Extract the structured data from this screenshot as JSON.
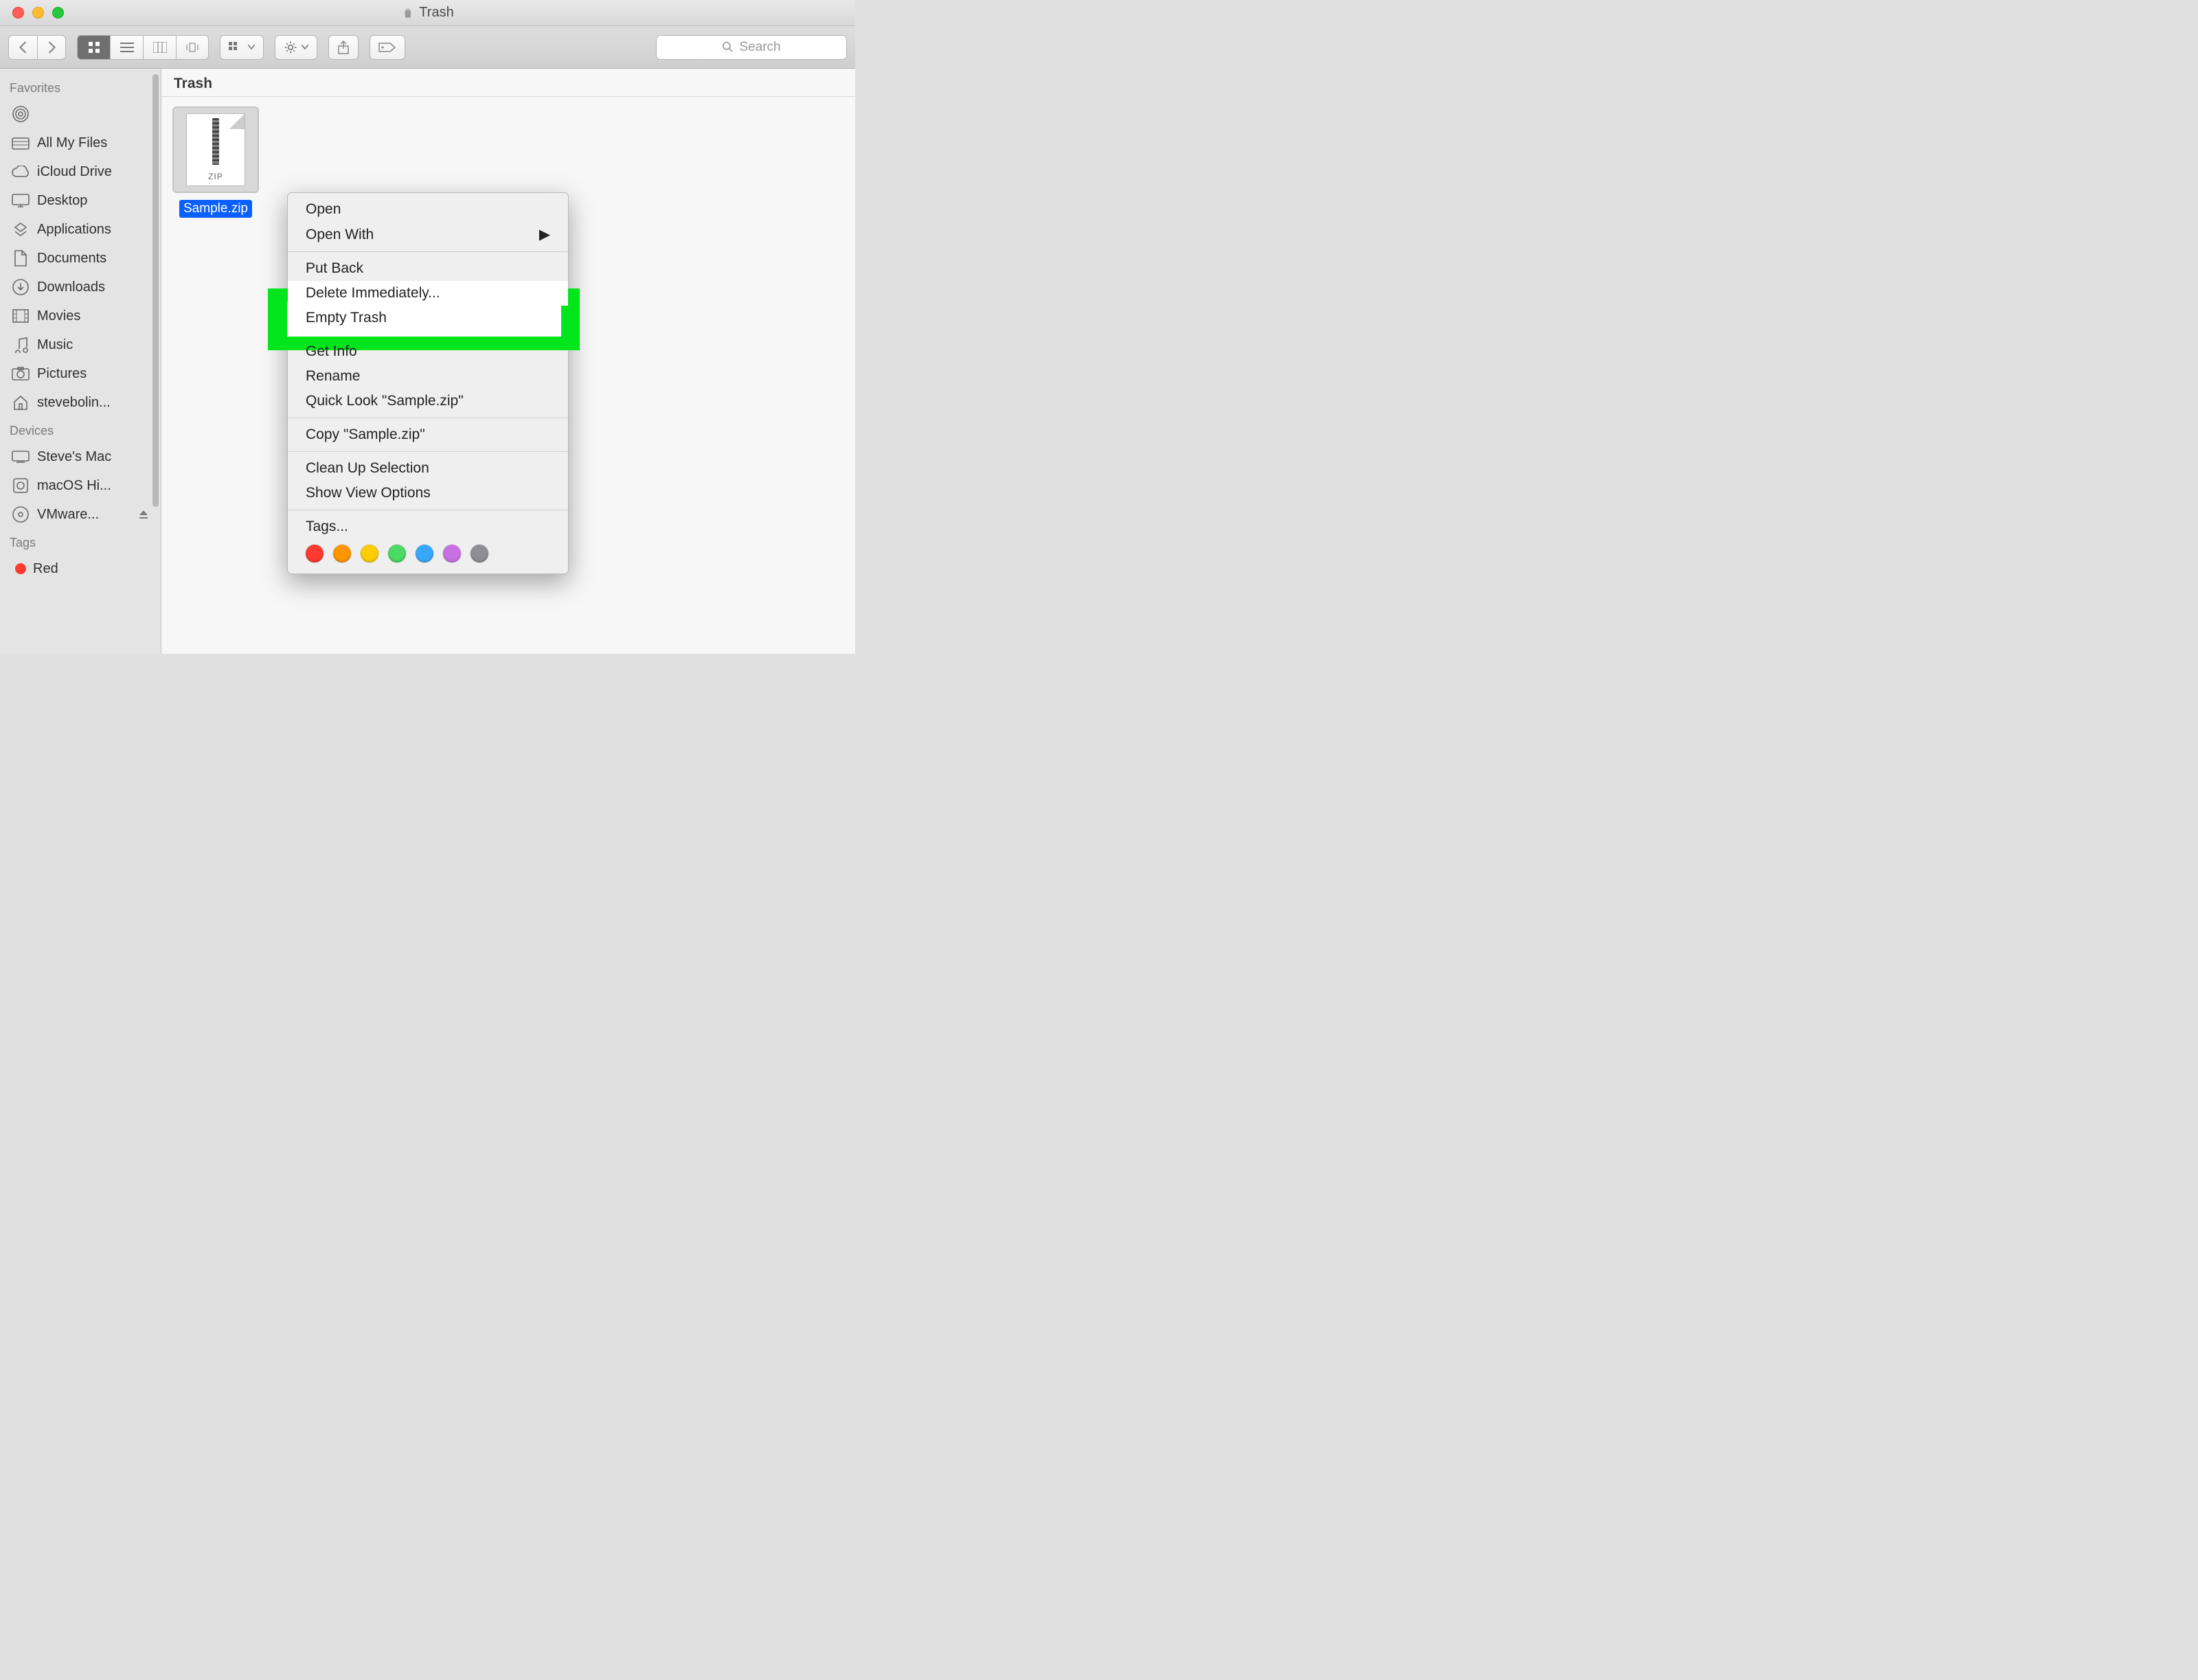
{
  "window": {
    "title": "Trash"
  },
  "toolbar": {
    "search_placeholder": "Search"
  },
  "sidebar": {
    "favorites_heading": "Favorites",
    "favorites": [
      {
        "label": "All My Files",
        "icon": "all-files-icon"
      },
      {
        "label": "iCloud Drive",
        "icon": "cloud-icon"
      },
      {
        "label": "Desktop",
        "icon": "desktop-icon"
      },
      {
        "label": "Applications",
        "icon": "applications-icon"
      },
      {
        "label": "Documents",
        "icon": "documents-icon"
      },
      {
        "label": "Downloads",
        "icon": "downloads-icon"
      },
      {
        "label": "Movies",
        "icon": "movies-icon"
      },
      {
        "label": "Music",
        "icon": "music-icon"
      },
      {
        "label": "Pictures",
        "icon": "pictures-icon"
      },
      {
        "label": "stevebolin...",
        "icon": "home-icon"
      }
    ],
    "devices_heading": "Devices",
    "devices": [
      {
        "label": "Steve's Mac",
        "icon": "computer-icon"
      },
      {
        "label": "macOS Hi...",
        "icon": "disk-icon"
      },
      {
        "label": "VMware... ",
        "icon": "disc-icon",
        "ejectable": true
      }
    ],
    "tags_heading": "Tags",
    "tags": [
      {
        "label": "Red",
        "color": "#ff3b30"
      }
    ]
  },
  "main": {
    "location": "Trash",
    "file": {
      "name": "Sample.zip",
      "type_label": "ZIP"
    }
  },
  "context_menu": {
    "open": "Open",
    "open_with": "Open With",
    "put_back": "Put Back",
    "delete_immediately": "Delete Immediately...",
    "empty_trash": "Empty Trash",
    "get_info": "Get Info",
    "rename": "Rename",
    "quick_look": "Quick Look \"Sample.zip\"",
    "copy": "Copy \"Sample.zip\"",
    "clean_up": "Clean Up Selection",
    "view_options": "Show View Options",
    "tags_label": "Tags...",
    "tag_colors": [
      "#ff3b30",
      "#ff9500",
      "#ffcc00",
      "#4cd964",
      "#38a8ff",
      "#c971e3",
      "#8e8e93"
    ]
  }
}
